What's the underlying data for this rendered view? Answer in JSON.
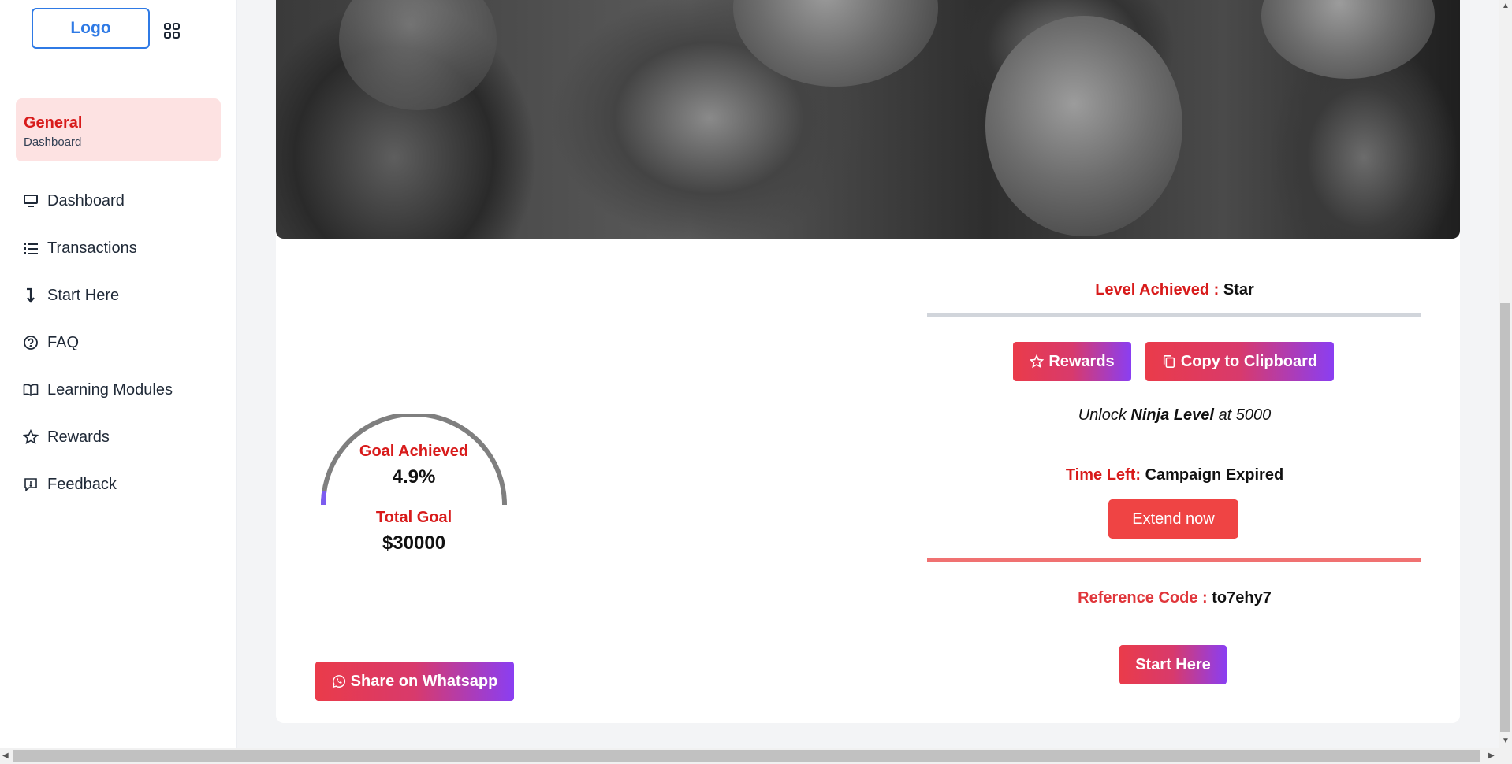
{
  "sidebar": {
    "logo_label": "Logo",
    "section_title": "General",
    "section_subtitle": "Dashboard",
    "items": [
      {
        "label": "Dashboard",
        "icon": "monitor-icon"
      },
      {
        "label": "Transactions",
        "icon": "list-icon"
      },
      {
        "label": "Start Here",
        "icon": "arrow-down-icon"
      },
      {
        "label": "FAQ",
        "icon": "question-circle-icon"
      },
      {
        "label": "Learning Modules",
        "icon": "book-icon"
      },
      {
        "label": "Rewards",
        "icon": "star-icon"
      },
      {
        "label": "Feedback",
        "icon": "feedback-icon"
      }
    ]
  },
  "goal": {
    "achieved_label": "Goal Achieved",
    "achieved_value": "4.9%",
    "achieved_fraction": 0.049,
    "total_label": "Total Goal",
    "total_value": "$30000",
    "share_label": "Share on Whatsapp"
  },
  "status": {
    "level_label": "Level Achieved :",
    "level_value": "Star",
    "rewards_label": "Rewards",
    "copy_label": "Copy to Clipboard",
    "unlock_prefix": "Unlock",
    "unlock_level": "Ninja Level",
    "unlock_suffix": "at 5000",
    "time_label": "Time Left:",
    "time_value": "Campaign Expired",
    "extend_label": "Extend now",
    "ref_label": "Reference Code :",
    "ref_value": "to7ehy7",
    "start_label": "Start Here"
  },
  "colors": {
    "accent_red": "#d81b1b",
    "gradient_start": "#ea3b4a",
    "gradient_end": "#8a3ef2",
    "logo_blue": "#2f7ae5",
    "gauge_progress": "#7c5cf0",
    "gauge_track": "#7f7f7f"
  }
}
